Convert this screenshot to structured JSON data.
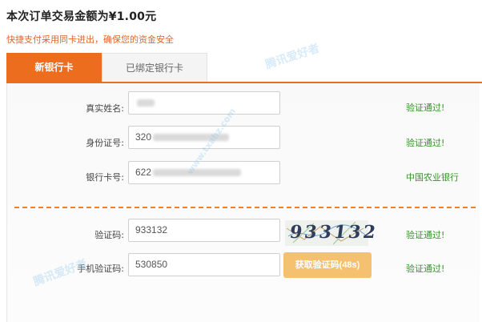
{
  "header": {
    "title": "本次订单交易金额为¥1.00元",
    "subtitle": "快捷支付采用同卡进出，确保您的资金安全"
  },
  "tabs": [
    {
      "label": "新银行卡",
      "active": true
    },
    {
      "label": "已绑定银行卡",
      "active": false
    }
  ],
  "form": {
    "name": {
      "label": "真实姓名:",
      "status": "验证通过!"
    },
    "id_number": {
      "label": "身份证号:",
      "value_prefix": "320",
      "status": "验证通过!"
    },
    "card_number": {
      "label": "银行卡号:",
      "value_prefix": "622",
      "status": "中国农业银行"
    },
    "captcha": {
      "label": "验证码:",
      "value": "933132",
      "image_text": "933132",
      "status": "验证通过!"
    },
    "sms_code": {
      "label": "手机验证码:",
      "value": "530850",
      "button_label": "获取验证码(48s)",
      "status": "验证通过!"
    }
  },
  "watermark": {
    "text": "腾讯爱好者",
    "url": "www.txahz.com"
  },
  "colors": {
    "accent": "#ed6d1f",
    "success": "#3a8f2f",
    "button": "#f5c06f"
  }
}
